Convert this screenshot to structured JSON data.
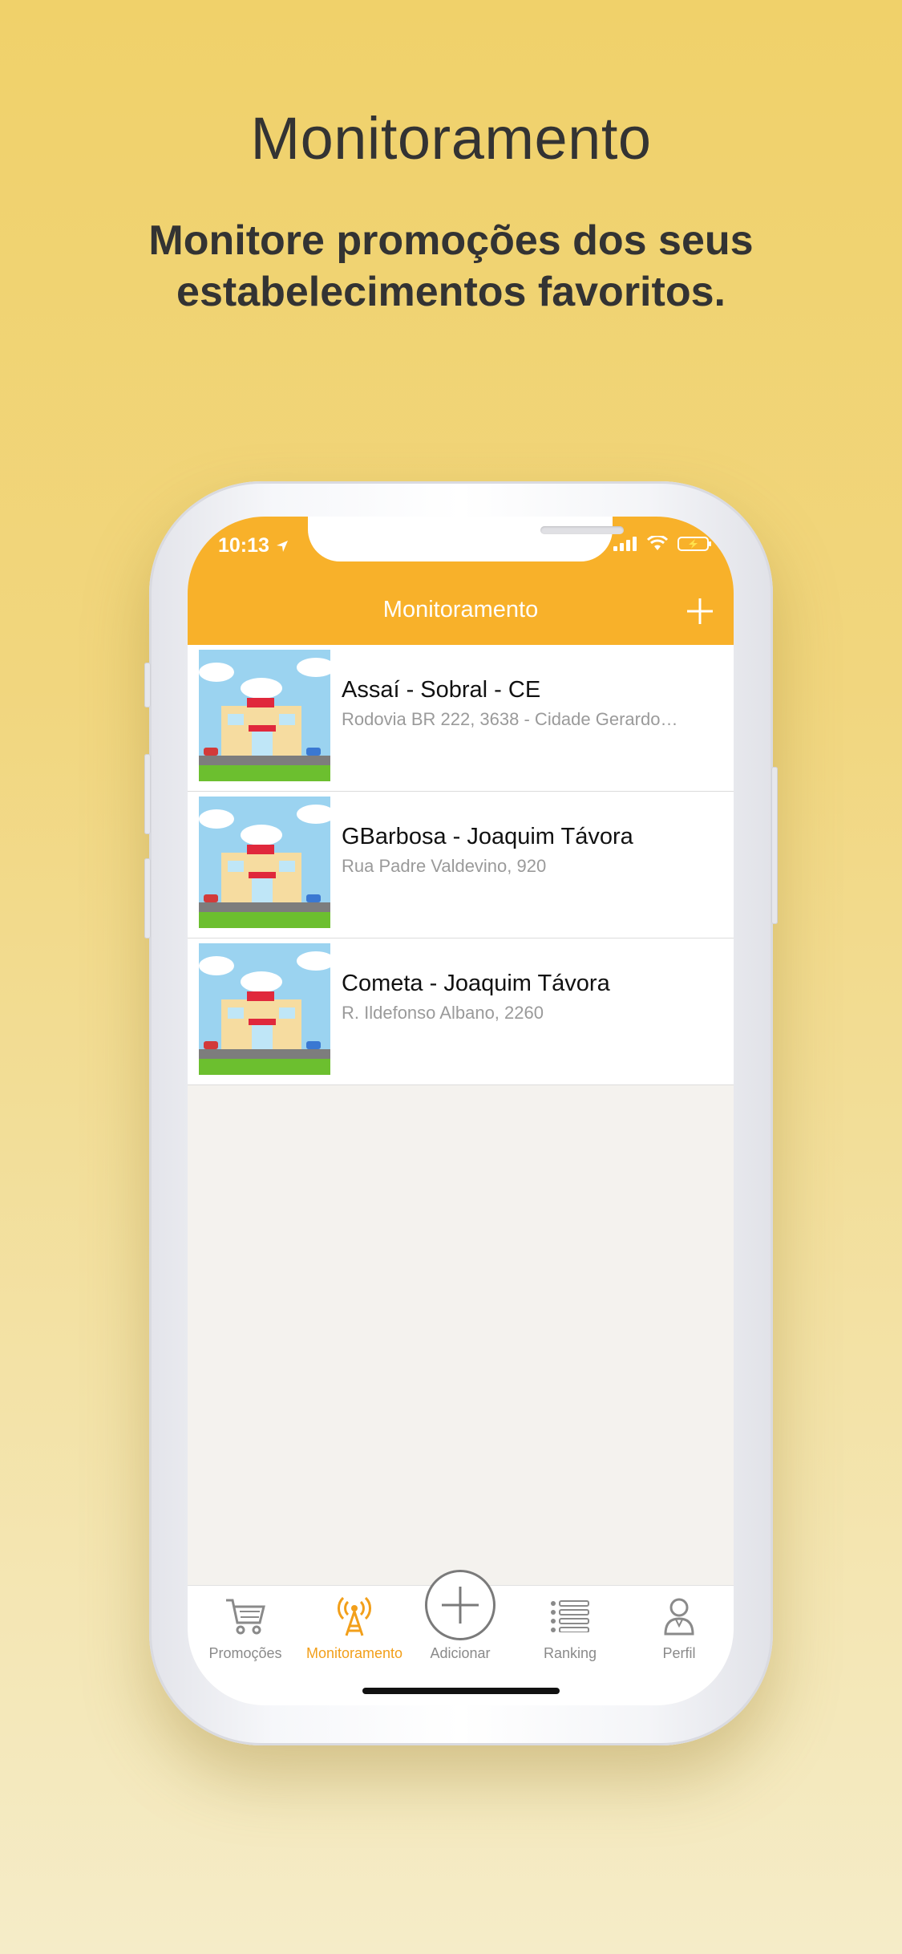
{
  "headline": "Monitoramento",
  "subhead": [
    "Monitore promoções dos seus",
    "estabelecimentos favoritos."
  ],
  "status_bar": {
    "time": "10:13",
    "icons": [
      "location-arrow-icon",
      "signal-icon",
      "wifi-icon",
      "battery-charging-icon"
    ]
  },
  "nav": {
    "title": "Monitoramento",
    "add_icon": "plus-icon"
  },
  "stores": [
    {
      "name": "Assaí - Sobral - CE",
      "address": "Rodovia BR 222, 3638 - Cidade Gerardo…"
    },
    {
      "name": "GBarbosa - Joaquim Távora",
      "address": "Rua Padre Valdevino, 920"
    },
    {
      "name": "Cometa - Joaquim Távora",
      "address": "R. Ildefonso Albano, 2260"
    }
  ],
  "tabs": [
    {
      "label": "Promoções",
      "icon": "cart-icon",
      "active": false
    },
    {
      "label": "Monitoramento",
      "icon": "antenna-icon",
      "active": true
    },
    {
      "label": "Adicionar",
      "icon": "plus-circle-icon",
      "active": false
    },
    {
      "label": "Ranking",
      "icon": "list-icon",
      "active": false
    },
    {
      "label": "Perfil",
      "icon": "person-icon",
      "active": false
    }
  ],
  "colors": {
    "accent": "#f8b12a",
    "active_tab": "#f29f1a",
    "background": "#f0d16a"
  }
}
